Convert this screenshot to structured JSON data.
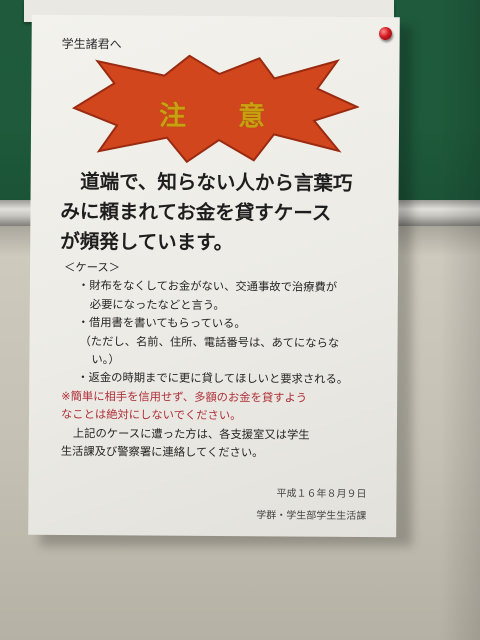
{
  "notice": {
    "addressee": "学生諸君へ",
    "heading": "注意",
    "lead_lines": [
      "　道端で、知らない人から言葉巧",
      "みに頼まれてお金を貸すケース",
      "が頻発しています。"
    ],
    "body_lines": [
      {
        "text": "＜ケース＞",
        "indent": 6,
        "style": "normal"
      },
      {
        "text": "・財布をなくしてお金がない、交通事故で治療費が",
        "indent": 20,
        "style": "normal"
      },
      {
        "text": "必要になったなどと言う。",
        "indent": 32,
        "style": "normal"
      },
      {
        "text": "・借用書を書いてもらっている。",
        "indent": 20,
        "style": "normal"
      },
      {
        "text": "（ただし、名前、住所、電話番号は、あてにならな",
        "indent": 22,
        "style": "normal"
      },
      {
        "text": "い。）",
        "indent": 34,
        "style": "normal"
      },
      {
        "text": "・返金の時期までに更に貸してほしいと要求される。",
        "indent": 20,
        "style": "normal"
      },
      {
        "text": "※簡単に相手を信用せず、多額のお金を貸すよう",
        "indent": 4,
        "style": "warn"
      },
      {
        "text": "なことは絶対にしないでください。",
        "indent": 4,
        "style": "warn"
      },
      {
        "text": "上記のケースに遭った方は、各支援室又は学生",
        "indent": 16,
        "style": "normal"
      },
      {
        "text": "生活課及び警察署に連絡してください。",
        "indent": 4,
        "style": "normal"
      }
    ],
    "date": "平成１６年８月９日",
    "issuer": "学群・学生部学生生活課"
  },
  "colors": {
    "burst_fill": "#d2461e",
    "burst_stroke": "#9a2a10",
    "heading_text": "#c8a010",
    "warning_text": "#b0303a",
    "board": "#1f5a3c",
    "pin": "#d01a22"
  },
  "icons": {
    "burst": "starburst-shape",
    "pin": "push-pin-icon"
  }
}
